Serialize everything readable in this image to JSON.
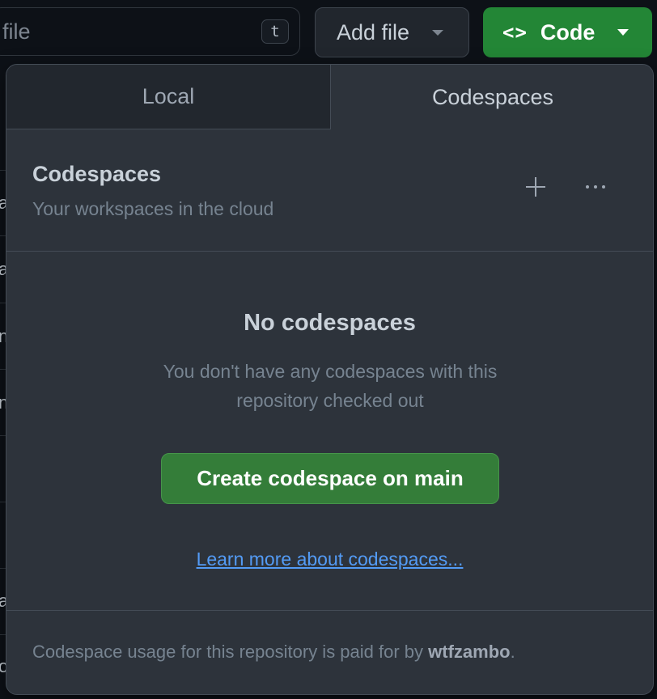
{
  "toolbar": {
    "search_text": "file",
    "search_shortcut": "t",
    "add_file_label": "Add file",
    "code_icon": "<>",
    "code_label": "Code"
  },
  "panel": {
    "tabs": [
      {
        "label": "Local",
        "active": false
      },
      {
        "label": "Codespaces",
        "active": true
      }
    ],
    "section": {
      "title": "Codespaces",
      "subtitle": "Your workspaces in the cloud",
      "plus_icon": "plus-icon",
      "more_icon": "kebab-horizontal-icon"
    },
    "empty_state": {
      "title": "No codespaces",
      "description": "You don't have any codespaces with this repository checked out",
      "create_button_label": "Create codespace on main",
      "learn_more_link": "Learn more about codespaces..."
    },
    "footer": {
      "text_prefix": "Codespace usage for this repository is paid for by ",
      "owner": "wtfzambo",
      "text_suffix": "."
    }
  },
  "background": {
    "row_glyphs": [
      "a",
      "a",
      "n",
      "n",
      "a",
      "o"
    ]
  },
  "colors": {
    "primary_green": "#238636",
    "create_green": "#347d39",
    "link_blue": "#539bf5",
    "panel_bg": "#2d333b",
    "page_bg": "#0d1117"
  }
}
